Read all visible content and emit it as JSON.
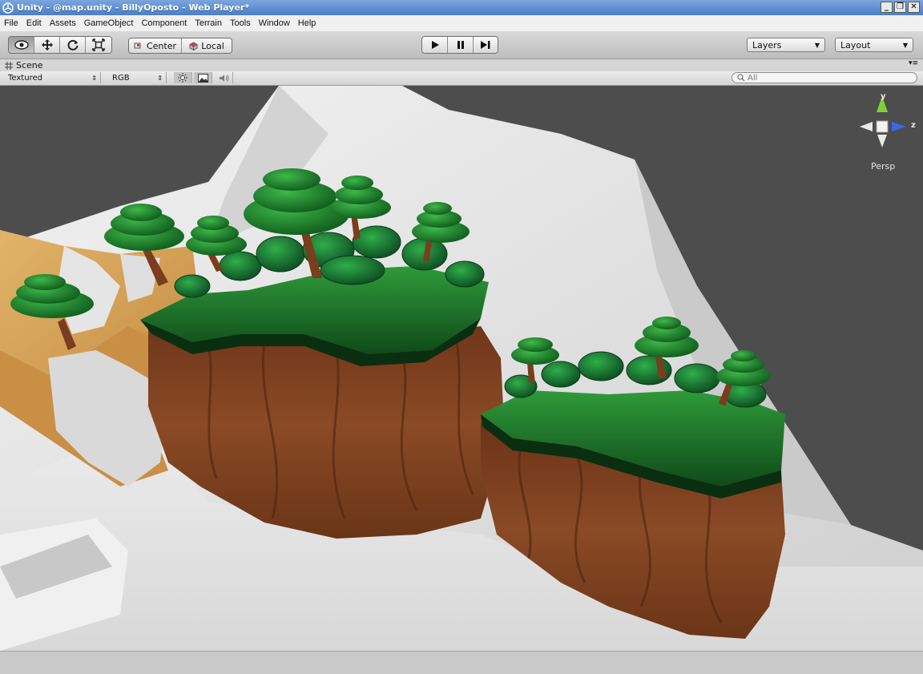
{
  "window": {
    "title": "Unity - @map.unity - BillyOposto - Web Player*"
  },
  "menu": [
    "File",
    "Edit",
    "Assets",
    "GameObject",
    "Component",
    "Terrain",
    "Tools",
    "Window",
    "Help"
  ],
  "toolbar": {
    "pivot_label": "Center",
    "space_label": "Local",
    "layers_label": "Layers",
    "layout_label": "Layout"
  },
  "scene": {
    "tab_label": "Scene",
    "draw_mode": "Textured",
    "render_mode": "RGB",
    "search_placeholder": "All",
    "projection_label": "Persp",
    "gizmo_axes": {
      "y": "y",
      "z": "z"
    }
  },
  "colors": {
    "title_bar": "#5a8bd0",
    "viewport_bg": "#4e4e4e",
    "grass": "#1f7a2a",
    "rock": "#7a3f22",
    "snow": "#e6e6e6",
    "gizmo_y": "#7fd13c",
    "gizmo_z": "#3a68e8"
  }
}
